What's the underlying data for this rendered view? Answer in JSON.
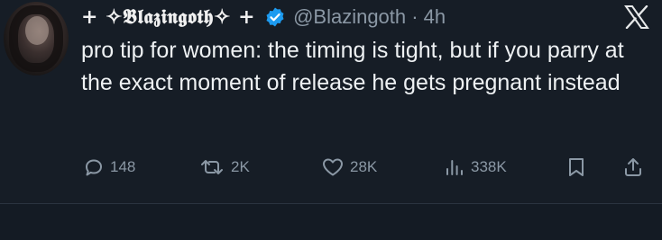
{
  "tweet": {
    "display_name": "+ ✧𝕭𝖑𝖆𝖟𝖎𝖓𝖌𝖔𝖙𝖍✧ +",
    "handle_time": "@Blazingoth · 4h",
    "text": "pro tip for women: the timing is tight, but if you parry at the exact moment of release he gets pregnant instead",
    "verified_icon": "verified-badge-icon",
    "platform_icon": "x-logo-icon"
  },
  "actions": {
    "replies": "148",
    "reposts": "2K",
    "likes": "28K",
    "views": "338K"
  },
  "colors": {
    "background": "#161d26",
    "text": "#eef1f3",
    "muted": "#8b98a5",
    "verified": "#1d9bf0"
  }
}
